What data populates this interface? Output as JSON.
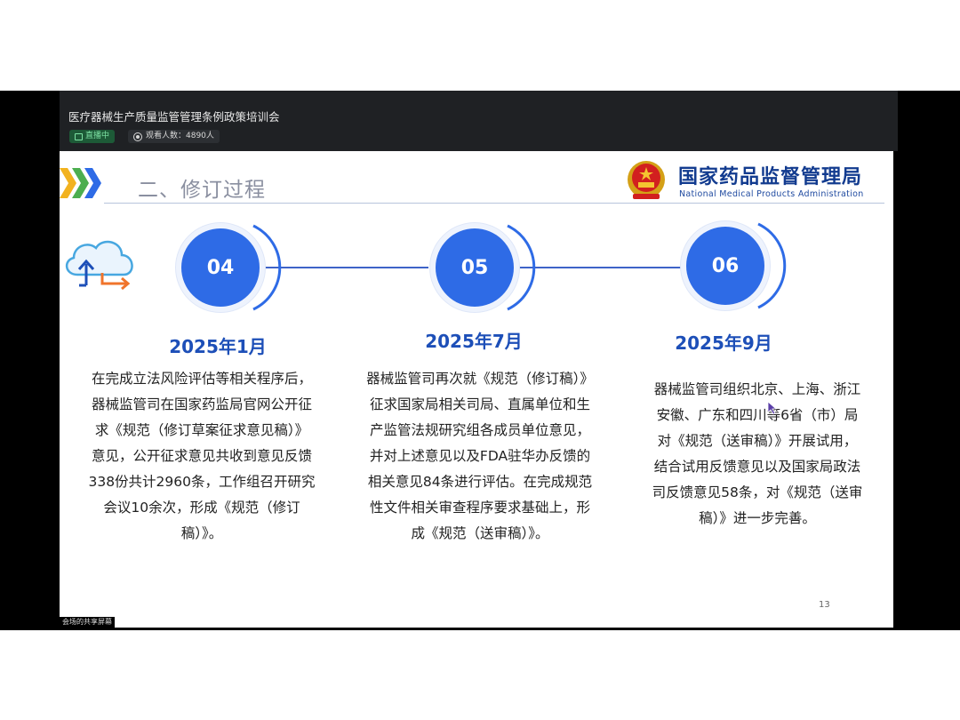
{
  "live": {
    "title": "医疗器械生产质量监管管理条例政策培训会",
    "status": "直播中",
    "viewers": "观看人数：4890人"
  },
  "slide": {
    "section_title": "二、修订过程",
    "org_cn": "国家药品监督管理局",
    "org_en": "National Medical Products Administration",
    "page_number": "13",
    "steps": [
      {
        "num": "04",
        "date": "2025年1月",
        "lines": [
          "在完成立法风险评估等相关程序后，",
          "器械监管司在国家药监局官网公开征",
          "求《规范（修订草案征求意见稿）》",
          "意见，公开征求意见共收到意见反馈",
          "338份共计2960条，工作组召开研究",
          "会议10余次，形成《规范（修订",
          "稿）》。"
        ]
      },
      {
        "num": "05",
        "date": "2025年7月",
        "lines": [
          "器械监管司再次就《规范（修订稿）》",
          "征求国家局相关司局、直属单位和生",
          "产监管法规研究组各成员单位意见，",
          "并对上述意见以及FDA驻华办反馈的",
          "相关意见84条进行评估。在完成规范",
          "性文件相关审查程序要求基础上，形",
          "成《规范（送审稿）》。"
        ]
      },
      {
        "num": "06",
        "date": "2025年9月",
        "lines": [
          "器械监管司组织北京、上海、浙江",
          "安徽、广东和四川等6省（市）局",
          "对《规范（送审稿）》开展试用，",
          "结合试用反馈意见以及国家局政法",
          "司反馈意见58条，对《规范（送审",
          "稿）》进一步完善。"
        ]
      }
    ]
  },
  "share_label": "会场的共享屏幕",
  "colors": {
    "accent_blue": "#2e6be6",
    "title_blue": "#123b8f",
    "live_green": "#1d5a37"
  }
}
